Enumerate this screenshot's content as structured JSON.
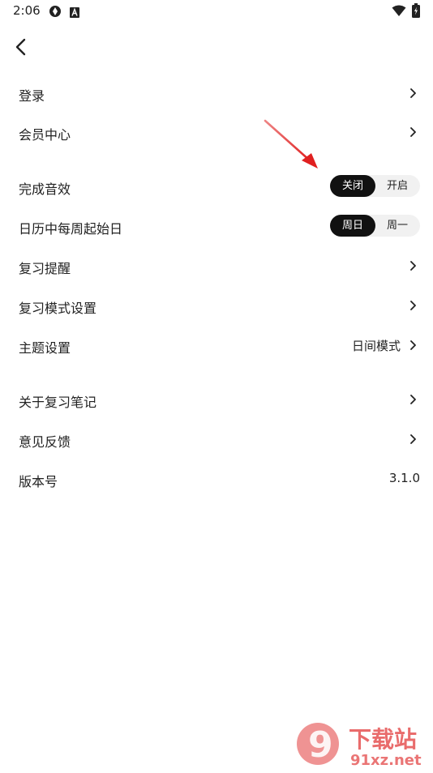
{
  "status_bar": {
    "time": "2:06",
    "icons": [
      "photo-icon",
      "a-icon",
      "wifi-icon",
      "battery-icon"
    ]
  },
  "header": {
    "back_icon": "chevron-left-icon"
  },
  "rows": {
    "login": {
      "label": "登录"
    },
    "member_center": {
      "label": "会员中心"
    },
    "completion_sound": {
      "label": "完成音效",
      "options": [
        "关闭",
        "开启"
      ],
      "selected": "关闭"
    },
    "week_start": {
      "label": "日历中每周起始日",
      "options": [
        "周日",
        "周一"
      ],
      "selected": "周日"
    },
    "review_reminder": {
      "label": "复习提醒"
    },
    "review_mode_settings": {
      "label": "复习模式设置"
    },
    "theme_settings": {
      "label": "主题设置",
      "value": "日间模式"
    },
    "about": {
      "label": "关于复习笔记"
    },
    "feedback": {
      "label": "意见反馈"
    },
    "version": {
      "label": "版本号",
      "value": "3.1.0"
    }
  },
  "watermark": {
    "text_main": "下载站",
    "text_url": "91xz.net",
    "logo_number": "9"
  },
  "colors": {
    "toggle_active_bg": "#111111",
    "toggle_bg": "#f1f1f1",
    "annotation_arrow": "#e02020",
    "watermark": "#e23b3b"
  }
}
